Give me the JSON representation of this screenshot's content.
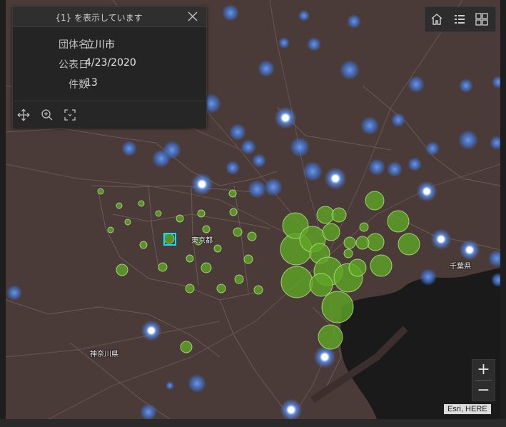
{
  "popup": {
    "title": "{1} を表示しています",
    "fields": [
      {
        "label": "団体名",
        "value": "立川市"
      },
      {
        "label": "公表日",
        "value": "4/23/2020"
      },
      {
        "label": "件数",
        "value": "13"
      }
    ]
  },
  "zoom": {
    "in_label": "+",
    "out_label": "−"
  },
  "attribution": "Esri, HERE",
  "labels": {
    "tokyo": "東京都",
    "kanagawa": "神奈川県",
    "chiba": "千葉県"
  },
  "colors": {
    "case_fill": "#5ea624",
    "case_stroke": "#b9e68a",
    "blue_glow": "#3f6fc7",
    "highlight": "#00e8ff",
    "land": "#4a3a38",
    "water": "#1a1a1b"
  }
}
